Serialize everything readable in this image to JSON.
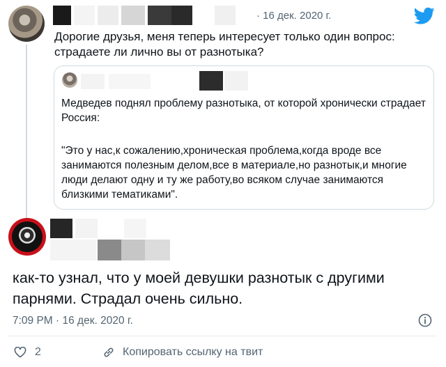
{
  "tweet": {
    "date": "· 16 дек. 2020 г.",
    "text": "Дорогие друзья, меня теперь интересует только один вопрос: страдаете ли лично вы от разнотыка?"
  },
  "quote": {
    "body": "Медведев поднял проблему разнотыка, от которой хронически страдает Россия:",
    "citation": "\"Это у нас,к сожалению,хроническая проблема,когда вроде все занимаются полезным делом,все в материале,но разнотык,и многие люди делают одну и ту же работу,во всяком случае занимаются близкими тематиками\"."
  },
  "reply": {
    "text": "как-то узнал, что у моей девушки разнотык с другими парнями. Страдал очень сильно.",
    "timestamp": "7:09 PM · 16 дек. 2020 г."
  },
  "actions": {
    "like_count": "2",
    "copy_link_label": "Копировать ссылку на твит"
  },
  "icons": {
    "brand": "twitter-bird-icon",
    "info": "info-icon",
    "like": "heart-icon",
    "link": "link-icon"
  },
  "colors": {
    "twitter_blue": "#1d9bf0",
    "secondary_text": "#536471",
    "border": "#cfd9de"
  }
}
